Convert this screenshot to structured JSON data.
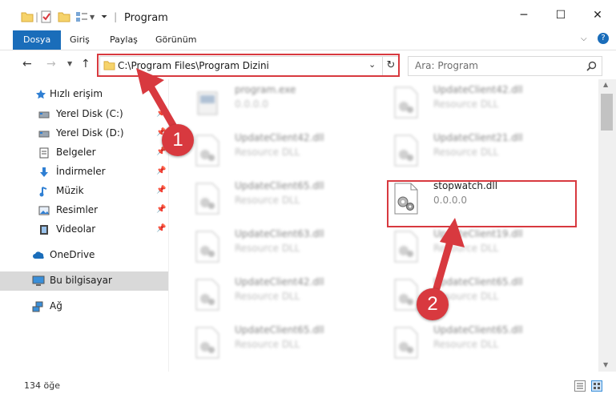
{
  "window": {
    "title": "Program",
    "controls": {
      "minimize": "─",
      "maximize": "☐",
      "close": "✕"
    }
  },
  "ribbon": {
    "tabs": [
      "Dosya",
      "Giriş",
      "Paylaş",
      "Görünüm"
    ]
  },
  "navigation": {
    "address": "C:\\Program Files\\Program Dizini",
    "search_placeholder": "Ara: Program"
  },
  "sidebar": {
    "items": [
      {
        "label": "Hızlı erişim",
        "icon": "star-icon",
        "pinned": false
      },
      {
        "label": "Yerel Disk (C:)",
        "icon": "drive-icon",
        "pinned": true
      },
      {
        "label": "Yerel Disk (D:)",
        "icon": "drive-icon",
        "pinned": true
      },
      {
        "label": "Belgeler",
        "icon": "documents-icon",
        "pinned": true
      },
      {
        "label": "İndirmeler",
        "icon": "download-icon",
        "pinned": true
      },
      {
        "label": "Müzik",
        "icon": "music-icon",
        "pinned": true
      },
      {
        "label": "Resimler",
        "icon": "pictures-icon",
        "pinned": true
      },
      {
        "label": "Videolar",
        "icon": "videos-icon",
        "pinned": true
      },
      {
        "label": "OneDrive",
        "icon": "cloud-icon",
        "pinned": false
      },
      {
        "label": "Bu bilgisayar",
        "icon": "computer-icon",
        "pinned": false,
        "selected": true
      },
      {
        "label": "Ağ",
        "icon": "network-icon",
        "pinned": false
      }
    ]
  },
  "files": [
    {
      "name": "program.exe",
      "sub": "0.0.0.0",
      "type": "exe"
    },
    {
      "name": "UpdateClient42.dll",
      "sub": "Resource DLL",
      "type": "dll"
    },
    {
      "name": "UpdateClient42.dll",
      "sub": "Resource DLL",
      "type": "dll"
    },
    {
      "name": "UpdateClient21.dll",
      "sub": "Resource DLL",
      "type": "dll"
    },
    {
      "name": "UpdateClient65.dll",
      "sub": "Resource DLL",
      "type": "dll"
    },
    {
      "name": "stopwatch.dll",
      "sub": "0.0.0.0",
      "type": "dll",
      "highlight": true
    },
    {
      "name": "UpdateClient63.dll",
      "sub": "Resource DLL",
      "type": "dll"
    },
    {
      "name": "UpdateClient19.dll",
      "sub": "Resource DLL",
      "type": "dll"
    },
    {
      "name": "UpdateClient42.dll",
      "sub": "Resource DLL",
      "type": "dll"
    },
    {
      "name": "UpdateClient65.dll",
      "sub": "Resource DLL",
      "type": "dll"
    },
    {
      "name": "UpdateClient65.dll",
      "sub": "Resource DLL",
      "type": "dll"
    },
    {
      "name": "UpdateClient65.dll",
      "sub": "Resource DLL",
      "type": "dll"
    }
  ],
  "status": {
    "item_count": "134 öğe"
  },
  "annotations": {
    "step1": "1",
    "step2": "2",
    "color": "#d8393f"
  }
}
